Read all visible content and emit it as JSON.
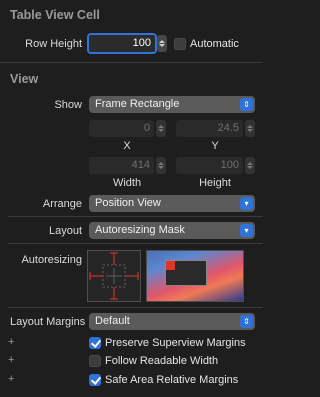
{
  "table_view_cell": {
    "title": "Table View Cell",
    "row_height_label": "Row Height",
    "row_height_value": "100",
    "automatic_label": "Automatic",
    "automatic_checked": false
  },
  "view": {
    "title": "View",
    "show_label": "Show",
    "show_value": "Frame Rectangle",
    "x_value": "0",
    "y_value": "24.5",
    "x_label": "X",
    "y_label": "Y",
    "width_value": "414",
    "height_value": "100",
    "width_label": "Width",
    "height_label": "Height",
    "arrange_label": "Arrange",
    "arrange_value": "Position View",
    "layout_label": "Layout",
    "layout_value": "Autoresizing Mask",
    "autoresizing_label": "Autoresizing",
    "layout_margins_label": "Layout Margins",
    "layout_margins_value": "Default",
    "checkboxes": [
      {
        "label": "Preserve Superview Margins",
        "checked": true
      },
      {
        "label": "Follow Readable Width",
        "checked": false
      },
      {
        "label": "Safe Area Relative Margins",
        "checked": true
      }
    ],
    "plus_symbol": "+"
  },
  "colors": {
    "accent": "#2f73d9",
    "strut": "#e0352b",
    "background": "#1e1e1e"
  }
}
